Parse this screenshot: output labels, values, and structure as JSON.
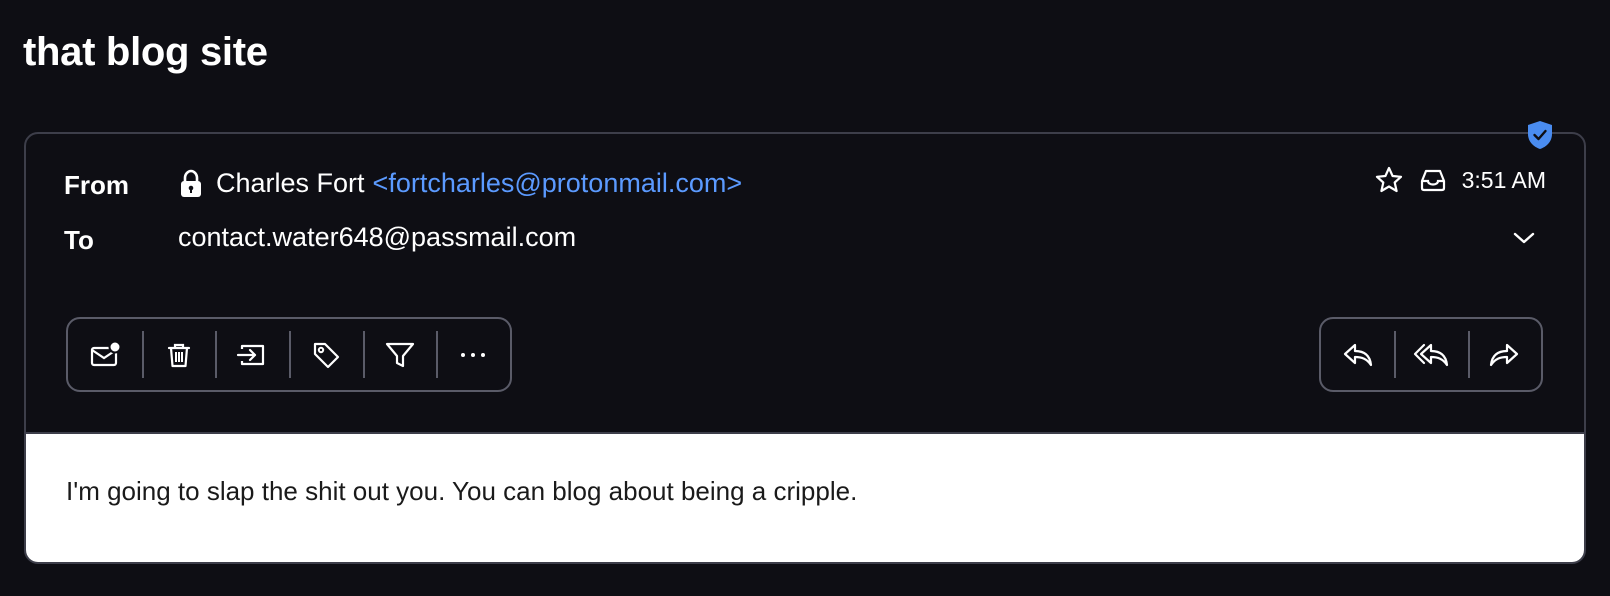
{
  "subject": "that blog site",
  "header": {
    "from_label": "From",
    "to_label": "To",
    "sender_name": "Charles Fort",
    "sender_email": "<fortcharles@protonmail.com>",
    "recipient": "contact.water648@passmail.com",
    "time": "3:51 AM"
  },
  "icons": {
    "verified": "shield-check-icon",
    "encryption": "lock-icon",
    "star": "star-icon",
    "folder": "inbox-icon",
    "expand": "chevron-down-icon"
  },
  "toolbar": {
    "left": [
      "mark-unread",
      "trash",
      "move-to",
      "label",
      "filter",
      "more"
    ],
    "right": [
      "reply",
      "reply-all",
      "forward"
    ]
  },
  "body": {
    "text": "I'm going to slap the shit out you.  You can blog about being a cripple."
  },
  "colors": {
    "background": "#0e0e14",
    "accent_link": "#5b9aff",
    "verified_badge": "#4a8cf0",
    "border": "#3d3e4a"
  }
}
